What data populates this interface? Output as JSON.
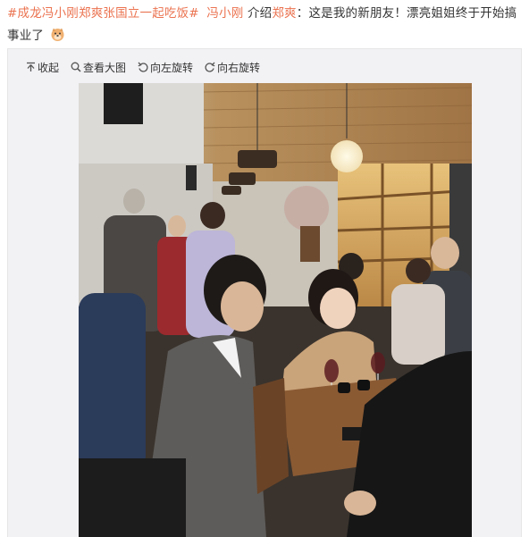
{
  "post": {
    "topic": "#成龙冯小刚郑爽张国立一起吃饭#",
    "mention1": "冯小刚",
    "text1": "介绍",
    "mention2": "郑爽",
    "text2": "：这是我的新朋友！漂亮姐姐终于开始搞事业了",
    "emoji_icon": "doge-emoji-icon"
  },
  "toolbar": {
    "collapse_label": "收起",
    "view_large_label": "查看大图",
    "rotate_left_label": "向左旋转",
    "rotate_right_label": "向右旋转",
    "icons": [
      "collapse-up-icon",
      "magnifier-icon",
      "rotate-left-icon",
      "rotate-right-icon"
    ]
  },
  "photo": {
    "subject": "restaurant-scene"
  },
  "colors": {
    "link": "#eb7350",
    "text": "#333333",
    "media_bg": "#f2f2f5"
  }
}
